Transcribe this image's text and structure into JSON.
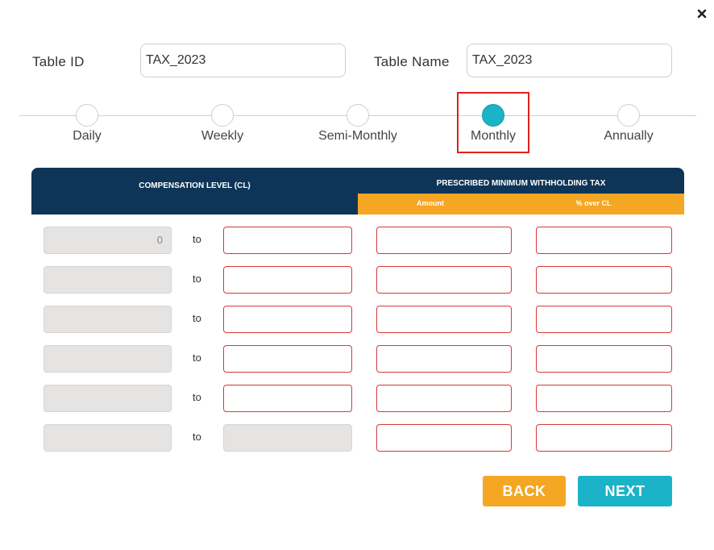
{
  "dialog": {
    "close_icon": "close-icon",
    "table_id_label": "Table ID",
    "table_id_value": "TAX_2023",
    "table_name_label": "Table Name",
    "table_name_value": "TAX_2023"
  },
  "frequency": {
    "options": [
      {
        "label": "Daily",
        "selected": false
      },
      {
        "label": "Weekly",
        "selected": false
      },
      {
        "label": "Semi-Monthly",
        "selected": false
      },
      {
        "label": "Monthly",
        "selected": true
      },
      {
        "label": "Annually",
        "selected": false
      }
    ],
    "active_color": "#1ab3c8",
    "highlight_color": "#e02020"
  },
  "table": {
    "header_cl": "COMPENSATION LEVEL (CL)",
    "header_tax": "PRESCRIBED MINIMUM WITHHOLDING TAX",
    "sub_amount": "Amount",
    "sub_percent": "% over CL",
    "header_color": "#0e3557",
    "subheader_color": "#f5a623",
    "to_label": "to",
    "rows": [
      {
        "cl_from": "0",
        "cl_to": "",
        "amount": "",
        "percent": ""
      },
      {
        "cl_from": "",
        "cl_to": "",
        "amount": "",
        "percent": ""
      },
      {
        "cl_from": "",
        "cl_to": "",
        "amount": "",
        "percent": ""
      },
      {
        "cl_from": "",
        "cl_to": "",
        "amount": "",
        "percent": ""
      },
      {
        "cl_from": "",
        "cl_to": "",
        "amount": "",
        "percent": ""
      },
      {
        "cl_from": "",
        "cl_to": "",
        "amount": "",
        "percent": ""
      }
    ]
  },
  "buttons": {
    "back_label": "BACK",
    "next_label": "NEXT",
    "back_color": "#f5a623",
    "next_color": "#1ab3c8"
  }
}
